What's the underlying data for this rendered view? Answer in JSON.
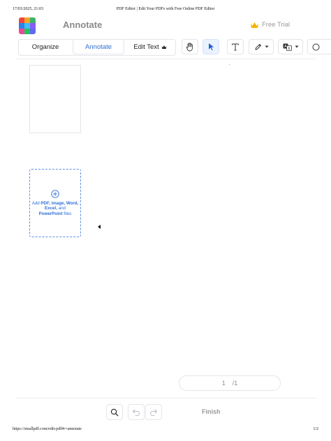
{
  "print": {
    "date": "17/03/2025, 21:03",
    "title": "PDF Editor | Edit Your PDFs with Free Online PDF Editor",
    "url": "https://smallpdf.com/edit-pdf#r=annotate",
    "page": "1/2"
  },
  "app": {
    "title": "Annotate",
    "free_trial": "Free Trial",
    "logo_colors": [
      "#f0473f",
      "#f5a623",
      "#3db36b",
      "#2f80ed",
      "#3ec1f0",
      "#8b5cf6",
      "#ec4899",
      "#22c55e",
      "#6366f1"
    ]
  },
  "toolbar": {
    "tabs": [
      {
        "label": "Organize"
      },
      {
        "label": "Annotate"
      },
      {
        "label": "Edit Text"
      }
    ],
    "active_tab": "Annotate",
    "tools": [
      {
        "icon": "hand-icon"
      },
      {
        "icon": "pointer-icon"
      },
      {
        "icon": "text-icon"
      },
      {
        "icon": "pen-icon"
      },
      {
        "icon": "translate-icon"
      },
      {
        "icon": "shape-icon"
      }
    ],
    "accent": "#2f6fd6"
  },
  "sidebar": {
    "add_files": {
      "prefix": "Add ",
      "bold1": "PDF, image, Word, Excel,",
      "mid": " and ",
      "bold2": "PowerPoint",
      "suffix": " files"
    }
  },
  "pager": {
    "current": "1",
    "total": "/1"
  },
  "bottom": {
    "finish_label": "Finish"
  }
}
